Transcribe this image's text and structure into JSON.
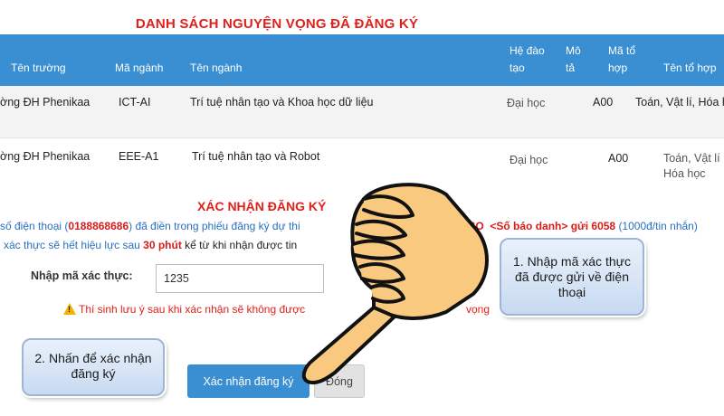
{
  "page_title": "DANH SÁCH NGUYỆN VỌNG ĐÃ ĐĂNG KÝ",
  "table": {
    "headers": {
      "ten_truong": "Tên trường",
      "ma_nganh": "Mã ngành",
      "ten_nganh": "Tên ngành",
      "he_dao_tao_1": "Hệ đào",
      "he_dao_tao_2": "tạo",
      "mo_ta_1": "Mô",
      "mo_ta_2": "tả",
      "ma_to_hop_1": "Mã tổ",
      "ma_to_hop_2": "hợp",
      "ten_to_hop": "Tên tổ hợp"
    },
    "rows": [
      {
        "ten_truong": "ờng ĐH Phenikaa",
        "ma_nganh": "ICT-AI",
        "ten_nganh": "Trí tuệ nhân tạo và Khoa học dữ liệu",
        "he_dao_tao": "Đại học",
        "ma_to_hop": "A00",
        "ten_to_hop_1": "Toán, Vật lí, Hóa h",
        "ten_to_hop_2": ""
      },
      {
        "ten_truong": "ờng ĐH Phenikaa",
        "ma_nganh": "EEE-A1",
        "ten_nganh": "Trí tuệ nhân tạo và Robot",
        "he_dao_tao": "Đại học",
        "ma_to_hop": "A00",
        "ten_to_hop_1": "Toán, Vật lí",
        "ten_to_hop_2": "Hóa học"
      }
    ]
  },
  "confirm": {
    "title": "XÁC NHẬN ĐĂNG KÝ",
    "line1": {
      "prefix": "số điện thoại (",
      "phone": "0188868686",
      "middle": ") đã điền trong phiếu đăng ký dự thi",
      "sms_keyword": "TSO",
      "sms_param": "<Số báo danh>",
      "sms_send": "gửi 6058",
      "fee": "(1000đ/tin nhắn)"
    },
    "line2": {
      "prefix": "xác thực sẽ hết hiệu lực sau",
      "duration": "30 phút",
      "suffix": "kể từ khi nhận được tin"
    },
    "code_label": "Nhập mã xác thực:",
    "code_value": "1235",
    "warning_start": "Thí sinh lưu ý sau khi xác nhận sẽ không được",
    "warning_end": "vọng",
    "confirm_button": "Xác nhận đăng ký",
    "close_button": "Đóng"
  },
  "callouts": {
    "step1": "1. Nhập mã xác thực đã được gửi về điện thoại",
    "step2": "2. Nhấn để xác nhận đăng ký"
  },
  "colors": {
    "header_blue": "#3a8fd2",
    "title_red": "#e0211b",
    "hand_skin": "#f8c97e"
  }
}
